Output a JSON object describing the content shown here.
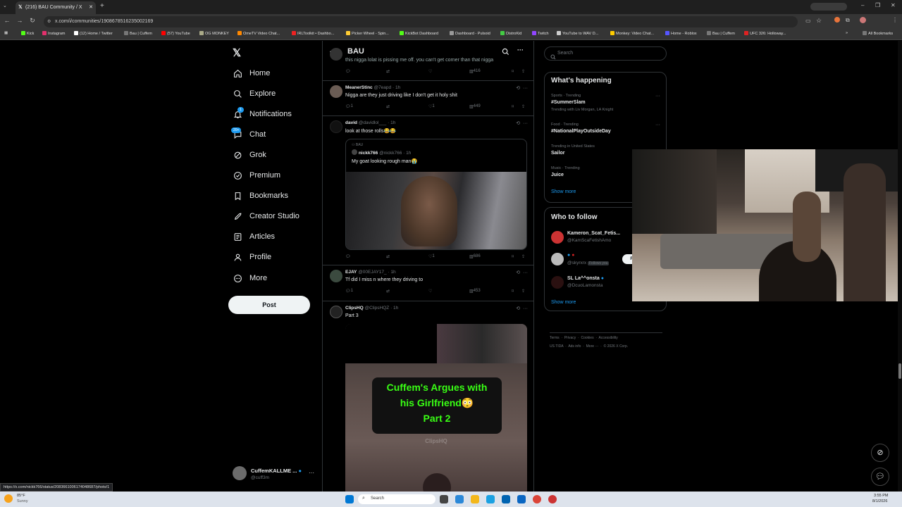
{
  "browser": {
    "tab_title": "(216) BAU Community / X",
    "url": "x.com/i/communities/1908678516235002169",
    "bookmarks": [
      "Kick",
      "Instagram",
      "(12) Home / Twitter",
      "Bau | Cuffem",
      "(57) YouTube",
      "OG MONKEY",
      "OmeTV Video Chat...",
      "IRLToolkit • Dashbo...",
      "Picker Wheel - Spin...",
      "KickBot Dashboard",
      "Dashboard - Pulsoid",
      "DistroKid",
      "Twitch",
      "YouTube to WAV D...",
      "Monkey: Video Chat...",
      "Home - Roblox",
      "Bau | Cuffem",
      "UFC 326: Holloway..."
    ],
    "all_bookmarks": "All Bookmarks",
    "status_url": "https://x.com/nickk766/status/2083661006174048687/photo/1"
  },
  "nav": {
    "items": [
      "Home",
      "Explore",
      "Notifications",
      "Chat",
      "Grok",
      "Premium",
      "Bookmarks",
      "Creator Studio",
      "Articles",
      "Profile",
      "More"
    ],
    "notif_badge": "1",
    "chat_badge": "20+",
    "post_label": "Post",
    "account_name": "CuffemKALLME ...",
    "account_handle": "@cuff3m"
  },
  "header": {
    "title": "BAU"
  },
  "tweets": [
    {
      "text": "this nigga lolat is pissing me off. you can't get corner than that nigga",
      "likes": "",
      "views": "416"
    },
    {
      "name": "MeanerStinc",
      "handle": "@7eapd",
      "time": "· 1h",
      "text": "Nigga are they just driving like I don't get it holy shit",
      "replies": "1",
      "likes": "1",
      "views": "449"
    },
    {
      "name": "david",
      "handle": "@davidlol___",
      "time": "· 1h",
      "text": "look at those rolls😂😂",
      "quote_community": "BAU",
      "quote_name": "nickk766",
      "quote_handle": "@nickk766",
      "quote_time": "· 1h",
      "quote_text": "My goat looking rough man😭",
      "likes": "1",
      "views": "686"
    },
    {
      "name": "EJAY",
      "handle": "@00EJAY17_",
      "time": "· 1h",
      "text": "Tf did I miss n where they driving to",
      "replies": "1",
      "views": "453"
    },
    {
      "name": "ClipsHQ",
      "handle": "@ClipsHQZ",
      "time": "· 1h",
      "text": "Part 3",
      "video_title_1": "Cuffem's Argues with",
      "video_title_2": "his Girlfriend😳",
      "video_title_3": "Part 2",
      "video_watermark": "ClipsHQ"
    }
  ],
  "right": {
    "search_placeholder": "Search",
    "happening_title": "What's happening",
    "trends": [
      {
        "cat": "Sports · Trending",
        "name": "#SummerSlam",
        "sub": "Trending with Liv Morgan, LA Knight"
      },
      {
        "cat": "Food · Trending",
        "name": "#NationalPlayOutsideDay",
        "sub": ""
      },
      {
        "cat": "Trending in United States",
        "name": "Sailor",
        "sub": ""
      },
      {
        "cat": "Music · Trending",
        "name": "Juice",
        "sub": ""
      }
    ],
    "show_more": "Show more",
    "who_title": "Who to follow",
    "follow": [
      {
        "name": "Kameron_Scat_Fetis...",
        "handle": "@KamScaFetishAmo"
      },
      {
        "name": "",
        "handle": "@skyrxrx",
        "tag": "Follows you"
      },
      {
        "name": "SL La^^onsta",
        "handle": "@DcuoLamonsta"
      }
    ],
    "follow_btn": "Fo",
    "footer_1": [
      "Terms",
      "Privacy",
      "Cookies",
      "Accessibility"
    ],
    "footer_2": [
      "US TIDA",
      "Ads info",
      "More ···",
      "© 2026 X Corp."
    ]
  },
  "taskbar": {
    "weather_temp": "85°F",
    "weather_desc": "Sunny",
    "search": "Search",
    "time": "3:55 PM",
    "date": "8/1/2026"
  },
  "colors": {
    "accent": "#1d9bf0",
    "bg": "#000000",
    "border": "#2f3336",
    "muted": "#71767b",
    "text": "#e7e9ea",
    "video_text": "#39ff14"
  }
}
